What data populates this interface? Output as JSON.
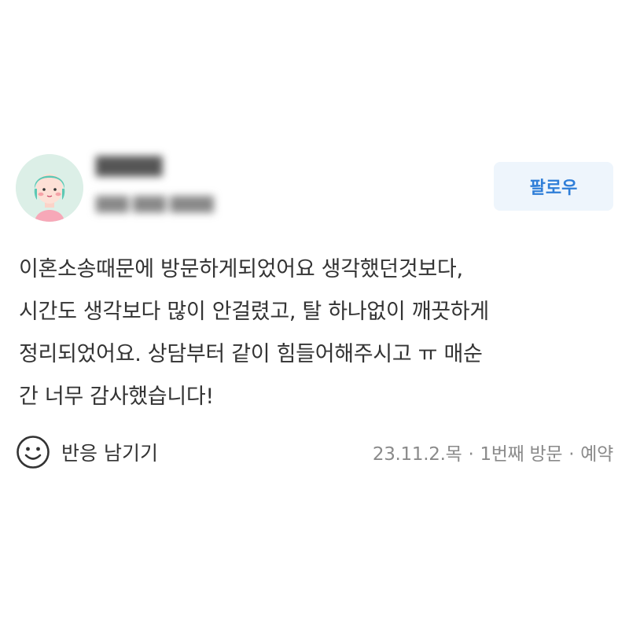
{
  "author": {
    "name": "█████",
    "meta": "███ ███  ████"
  },
  "follow_button": {
    "label": "팔로우"
  },
  "review": {
    "lines": [
      "이혼소송때문에 방문하게되었어요 생각했던것보다,",
      "시간도 생각보다 많이 안걸렸고, 탈 하나없이 깨끗하게",
      "정리되었어요. 상담부터 같이 힘들어해주시고 ㅠ 매순",
      "간 너무 감사했습니다!"
    ]
  },
  "footer": {
    "reaction_icon": "smile-icon",
    "reaction_label": "반응 남기기",
    "visit_date": "23.11.2.목",
    "visit_count": "1번째 방문",
    "visit_type": "예약",
    "separator": "·"
  },
  "colors": {
    "follow_text": "#2f7ed8",
    "follow_bg": "#eef5fc",
    "body_text": "#333333",
    "meta_text": "#8a8a8a",
    "avatar_bg": "#dcefe7"
  }
}
